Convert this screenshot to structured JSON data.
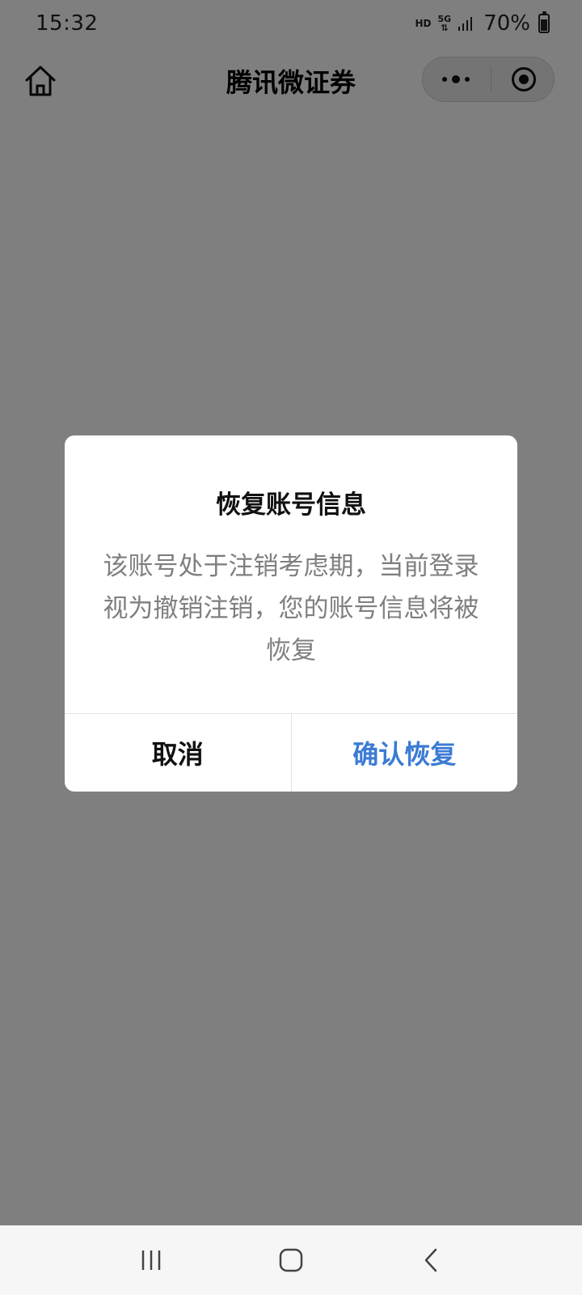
{
  "status_bar": {
    "time": "15:32",
    "hd_label": "HD",
    "network_label": "5G",
    "battery": "70%",
    "icons": [
      "signal-icon",
      "battery-icon"
    ]
  },
  "nav": {
    "title": "腾讯微证券",
    "home_icon": "home-icon",
    "more_icon": "more-dots-icon",
    "close_icon": "target-icon"
  },
  "dialog": {
    "title": "恢复账号信息",
    "body": "该账号处于注销考虑期，当前登录视为撤销注销，您的账号信息将被恢复",
    "cancel_label": "取消",
    "confirm_label": "确认恢复",
    "confirm_color": "#3b7bd4"
  },
  "system_nav": {
    "icons": [
      "recent-apps-icon",
      "home-button-icon",
      "back-icon"
    ]
  },
  "colors": {
    "overlay": "rgba(0,0,0,0.5)",
    "body_text": "#7f7f7f"
  }
}
